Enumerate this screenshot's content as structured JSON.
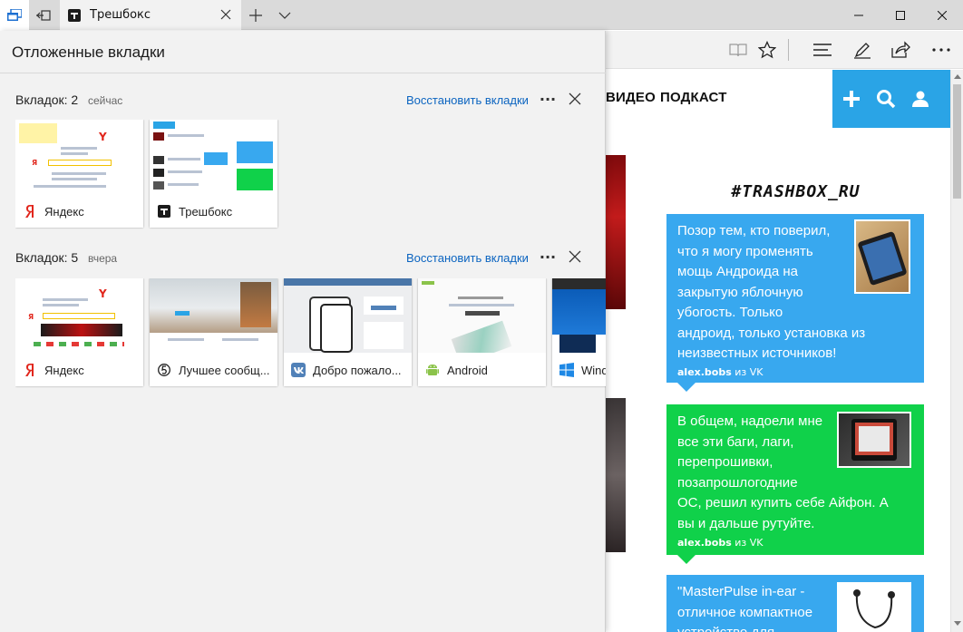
{
  "window": {
    "tab_title": "Трешбокс"
  },
  "panel": {
    "title": "Отложенные вкладки",
    "groups": [
      {
        "count_label": "Вкладок: 2",
        "when": "сейчас",
        "restore_label": "Восстановить вкладки",
        "more_label": "···",
        "tabs": [
          {
            "title": "Яндекс",
            "favicon": "yandex-icon"
          },
          {
            "title": "Трешбокс",
            "favicon": "trashbox-icon"
          }
        ]
      },
      {
        "count_label": "Вкладок: 5",
        "when": "вчера",
        "restore_label": "Восстановить вкладки",
        "more_label": "···",
        "tabs": [
          {
            "title": "Яндекс",
            "favicon": "yandex-icon"
          },
          {
            "title": "Лучшее сообщ...",
            "favicon": "site-5-icon"
          },
          {
            "title": "Добро пожало...",
            "favicon": "vk-icon"
          },
          {
            "title": "Android",
            "favicon": "android-icon"
          },
          {
            "title": "Windows",
            "favicon": "windows-icon"
          }
        ]
      }
    ]
  },
  "site": {
    "nav": [
      "ВИДЕО",
      "ПОДКАСТ"
    ],
    "hashtag": "#TRASHBOX_RU",
    "posts": [
      {
        "text_lines": [
          "Позор тем, кто поверил,",
          "что я могу променять",
          "мощь Андроида на",
          "закрытую яблочную",
          "убогость. Только",
          "андроид, только установка из",
          "неизвестных источников!"
        ],
        "author": "alex.bobs",
        "source": "из VK",
        "color": "#38a8ef"
      },
      {
        "text_lines": [
          "В общем, надоели мне",
          "все эти баги, лаги,",
          "перепрошивки,",
          "позапрошлогодние",
          "ОС, решил купить себе Айфон. А",
          "вы и дальше рутуйте."
        ],
        "author": "alex.bobs",
        "source": "из VK",
        "color": "#10d14a"
      },
      {
        "text_lines": [
          "\"MasterPulse in-ear -",
          "отличное компактное",
          "устройство для"
        ],
        "author": "",
        "source": "",
        "color": "#38a8ef"
      }
    ]
  },
  "colors": {
    "accent_link": "#0b64c0",
    "site_blue": "#2aa4e6",
    "post_blue": "#38a8ef",
    "post_green": "#10d14a"
  }
}
